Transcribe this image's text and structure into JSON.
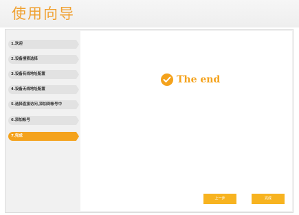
{
  "header": {
    "title": "使用向导"
  },
  "sidebar": {
    "steps": [
      {
        "label": "1.欢迎"
      },
      {
        "label": "2.设备搜索选择"
      },
      {
        "label": "3.设备有线地址配置"
      },
      {
        "label": "4.设备无线地址配置"
      },
      {
        "label": "5.选择直接访问,添加到帐号中"
      },
      {
        "label": "6.添加帐号"
      },
      {
        "label": "7.完成"
      }
    ],
    "active_index": 6
  },
  "main": {
    "end_text": "The end",
    "icon": "check-circle-icon",
    "prev_button": "上一步",
    "finish_button": "完成"
  },
  "colors": {
    "accent": "#f4a21c",
    "button": "#f7b320",
    "title": "#f0a030"
  }
}
